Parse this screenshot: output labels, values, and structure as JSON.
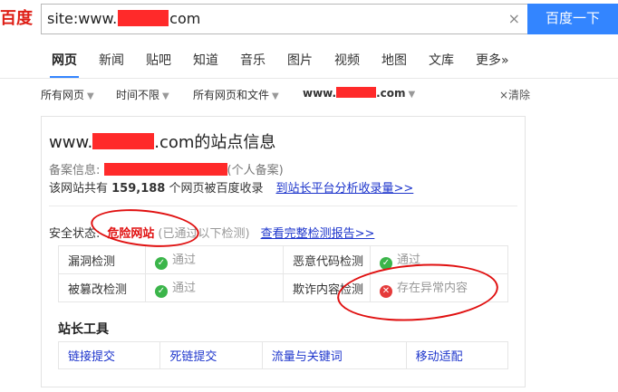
{
  "search": {
    "logo": "百度",
    "query_prefix": "site:www.",
    "query_suffix": "com",
    "clear_icon": "×",
    "button_label": "百度一下"
  },
  "tabs": [
    {
      "label": "网页",
      "active": true
    },
    {
      "label": "新闻"
    },
    {
      "label": "贴吧"
    },
    {
      "label": "知道"
    },
    {
      "label": "音乐"
    },
    {
      "label": "图片"
    },
    {
      "label": "视频"
    },
    {
      "label": "地图"
    },
    {
      "label": "文库"
    },
    {
      "label": "更多»"
    }
  ],
  "filters": {
    "all_pages": "所有网页",
    "time": "时间不限",
    "filetype": "所有网页和文件",
    "site_prefix": "www.",
    "site_suffix": ".com",
    "clear": "×清除"
  },
  "card": {
    "title_prefix": "www.",
    "title_suffix": ".com的站点信息",
    "icp_label": "备案信息: ",
    "icp_suffix": "(个人备案)",
    "pages_prefix": "该网站共有 ",
    "pages_count": "159,188",
    "pages_suffix": " 个网页被百度收录",
    "pages_link": "到站长平台分析收录量>>",
    "security_label": "安全状态:",
    "security_value": "危险网站",
    "security_note": "(已通过以下检测)",
    "security_link": "查看完整检测报告>>",
    "checks": [
      {
        "name": "漏洞检测",
        "result": "通过",
        "status": "ok"
      },
      {
        "name": "恶意代码检测",
        "result": "通过",
        "status": "ok"
      },
      {
        "name": "被篡改检测",
        "result": "通过",
        "status": "ok"
      },
      {
        "name": "欺诈内容检测",
        "result": "存在异常内容",
        "status": "error"
      }
    ],
    "tools_title": "站长工具",
    "tools": [
      "链接提交",
      "死链提交",
      "流量与关键词",
      "移动适配"
    ]
  },
  "colors": {
    "accent": "#3385ff",
    "danger": "#e01010",
    "link": "#1d35cc",
    "ok": "#3bb54a"
  }
}
